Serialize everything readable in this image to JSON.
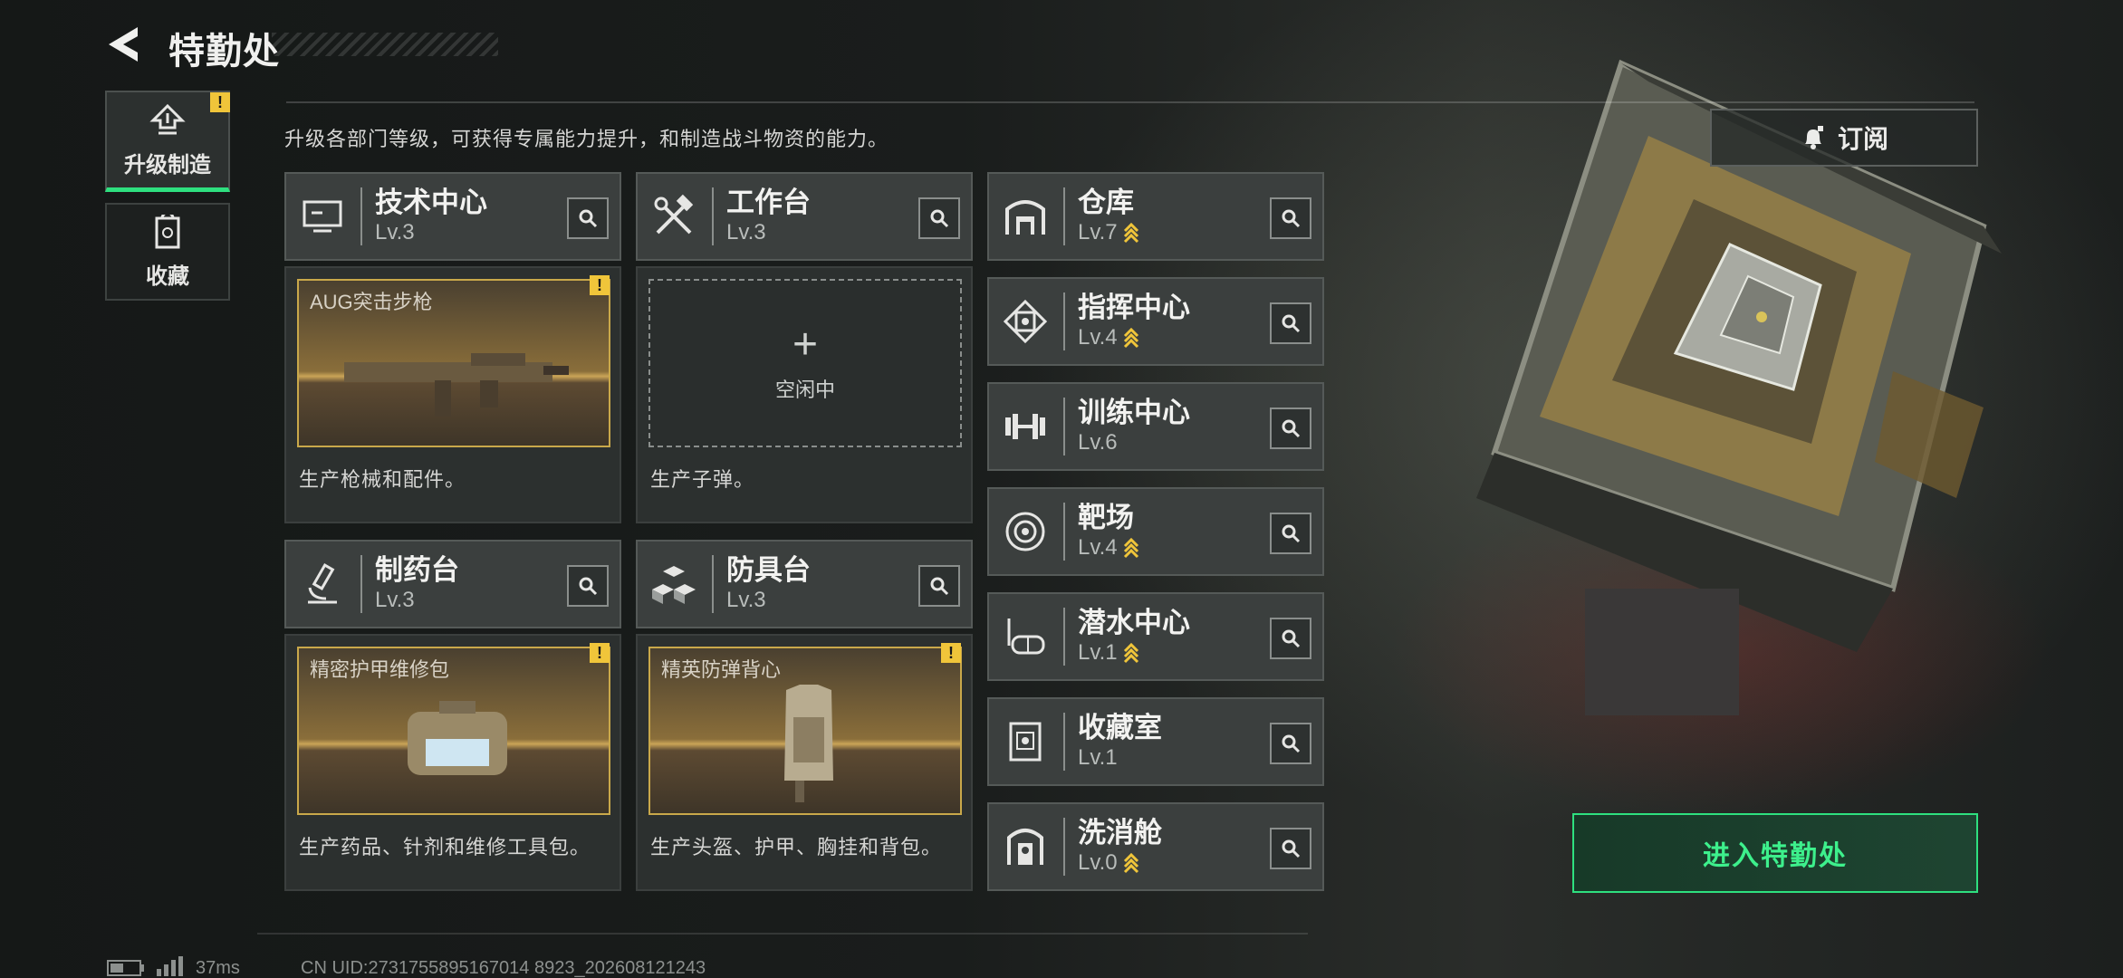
{
  "header": {
    "title": "特勤处"
  },
  "nav": [
    {
      "label": "升级制造",
      "icon": "upgrade-icon",
      "active": true,
      "alert": "!"
    },
    {
      "label": "收藏",
      "icon": "collection-icon",
      "active": false
    }
  ],
  "description": "升级各部门等级，可获得专属能力提升，和制造战斗物资的能力。",
  "subscribe": {
    "label": "订阅",
    "icon": "bell-icon"
  },
  "stations": [
    {
      "name": "技术中心",
      "level": "Lv.3",
      "icon": "monitor-icon",
      "slot": {
        "label": "AUG突击步枪",
        "alert": "!"
      },
      "desc": "生产枪械和配件。"
    },
    {
      "name": "工作台",
      "level": "Lv.3",
      "icon": "tools-icon",
      "slot": {
        "plus": "+",
        "idle": "空闲中"
      },
      "desc": "生产子弹。"
    },
    {
      "name": "制药台",
      "level": "Lv.3",
      "icon": "microscope-icon",
      "slot": {
        "label": "精密护甲维修包",
        "alert": "!"
      },
      "desc": "生产药品、针剂和维修工具包。"
    },
    {
      "name": "防具台",
      "level": "Lv.3",
      "icon": "cubes-icon",
      "slot": {
        "label": "精英防弹背心",
        "alert": "!"
      },
      "desc": "生产头盔、护甲、胸挂和背包。"
    }
  ],
  "facilities": [
    {
      "name": "仓库",
      "level": "Lv.7",
      "upgradable": true,
      "icon": "warehouse-icon"
    },
    {
      "name": "指挥中心",
      "level": "Lv.4",
      "upgradable": true,
      "icon": "command-chip-icon"
    },
    {
      "name": "训练中心",
      "level": "Lv.6",
      "upgradable": false,
      "icon": "dumbbell-icon"
    },
    {
      "name": "靶场",
      "level": "Lv.4",
      "upgradable": true,
      "icon": "target-icon"
    },
    {
      "name": "潜水中心",
      "level": "Lv.1",
      "upgradable": true,
      "icon": "dive-mask-icon"
    },
    {
      "name": "收藏室",
      "level": "Lv.1",
      "upgradable": false,
      "icon": "collection-room-icon"
    },
    {
      "name": "洗消舱",
      "level": "Lv.0",
      "upgradable": true,
      "icon": "decon-icon"
    }
  ],
  "enter_button": {
    "label": "进入特勤处"
  },
  "status_bar": {
    "ping": "37ms",
    "uid": "CN UID:2731755895167014 8923_202608121243"
  },
  "colors": {
    "accent_green": "#2ee07f",
    "alert_yellow": "#f0c53a",
    "gold": "#c9a84a"
  }
}
